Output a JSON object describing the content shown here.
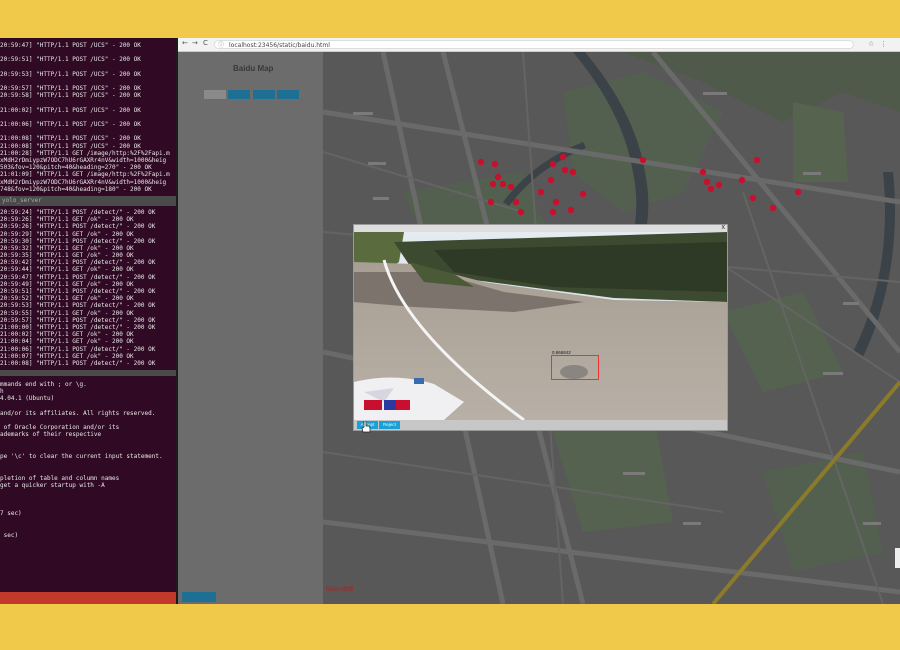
{
  "terminal": {
    "top_lines": [
      "20:59:47] \"HTTP/1.1 POST /UCS\" - 200 OK",
      "",
      "20:59:51] \"HTTP/1.1 POST /UCS\" - 200 OK",
      "",
      "20:59:53] \"HTTP/1.1 POST /UCS\" - 200 OK",
      "",
      "20:59:57] \"HTTP/1.1 POST /UCS\" - 200 OK",
      "20:59:58] \"HTTP/1.1 POST /UCS\" - 200 OK",
      "",
      "21:00:02] \"HTTP/1.1 POST /UCS\" - 200 OK",
      "",
      "21:00:06] \"HTTP/1.1 POST /UCS\" - 200 OK",
      "",
      "21:00:08] \"HTTP/1.1 POST /UCS\" - 200 OK",
      "21:00:08] \"HTTP/1.1 POST /UCS\" - 200 OK",
      "21:00:28] \"HTTP/1.1 GET /image/http:%2F%2Fapi.m",
      "xMdH2rDmiypzW7ODC7hU6rGAXRr4nV&width=1000&heig",
      "503&fov=120&pitch=40&heading=270\" - 200 OK",
      "21:01:09] \"HTTP/1.1 GET /image/http:%2F%2Fapi.m",
      "xMdH2rDmiypzW7ODC7hU6rGAXRr4nV&width=1000&heig",
      "748&fov=120&pitch=40&heading=180\" - 200 OK"
    ],
    "section_label": "yolo_server",
    "mid_lines": [
      "20:59:24] \"HTTP/1.1 POST /detect/\" - 200 OK",
      "20:59:26] \"HTTP/1.1 GET /ok\" - 200 OK",
      "20:59:26] \"HTTP/1.1 POST /detect/\" - 200 OK",
      "20:59:29] \"HTTP/1.1 GET /ok\" - 200 OK",
      "20:59:30] \"HTTP/1.1 POST /detect/\" - 200 OK",
      "20:59:32] \"HTTP/1.1 GET /ok\" - 200 OK",
      "20:59:35] \"HTTP/1.1 GET /ok\" - 200 OK",
      "20:59:42] \"HTTP/1.1 POST /detect/\" - 200 OK",
      "20:59:44] \"HTTP/1.1 GET /ok\" - 200 OK",
      "20:59:47] \"HTTP/1.1 POST /detect/\" - 200 OK",
      "20:59:49] \"HTTP/1.1 GET /ok\" - 200 OK",
      "20:59:51] \"HTTP/1.1 POST /detect/\" - 200 OK",
      "20:59:52] \"HTTP/1.1 GET /ok\" - 200 OK",
      "20:59:53] \"HTTP/1.1 POST /detect/\" - 200 OK",
      "20:59:55] \"HTTP/1.1 GET /ok\" - 200 OK",
      "20:59:57] \"HTTP/1.1 POST /detect/\" - 200 OK",
      "21:00:00] \"HTTP/1.1 POST /detect/\" - 200 OK",
      "21:00:02] \"HTTP/1.1 GET /ok\" - 200 OK",
      "21:00:04] \"HTTP/1.1 GET /ok\" - 200 OK",
      "21:00:06] \"HTTP/1.1 POST /detect/\" - 200 OK",
      "21:00:07] \"HTTP/1.1 GET /ok\" - 200 OK",
      "21:00:08] \"HTTP/1.1 POST /detect/\" - 200 OK"
    ],
    "bottom_lines": [
      "mmands end with ; or \\g.",
      "h",
      "4.04.1 (Ubuntu)",
      "",
      "and/or its affiliates. All rights reserved.",
      "",
      " of Oracle Corporation and/or its",
      "ademarks of their respective",
      "",
      "",
      "pe '\\c' to clear the current input statement.",
      "",
      "",
      "pletion of table and column names",
      "get a quicker startup with -A",
      "",
      "",
      "",
      "7 sec)",
      "",
      "",
      " sec)"
    ]
  },
  "browser": {
    "url": "localhost:23456/static/baidu.html",
    "nav_back": "←",
    "nav_forward": "→",
    "nav_reload": "C",
    "info_icon": "ⓘ",
    "star_icon": "☆",
    "menu_icon": "⋮"
  },
  "panel": {
    "title": "Baidu Map",
    "buttons": [
      "",
      "",
      "",
      ""
    ]
  },
  "map": {
    "logo_text": "Baidu地图"
  },
  "modal": {
    "close_label": "x",
    "detection_label": "0.966842",
    "accept_label": "Accept",
    "reject_label": "Reject"
  },
  "colors": {
    "accent": "#1aa0d6",
    "marker": "#c8102e",
    "detection_box": "#ee3333",
    "background_frame": "#f1c94a",
    "terminal_bg": "#300a24"
  }
}
